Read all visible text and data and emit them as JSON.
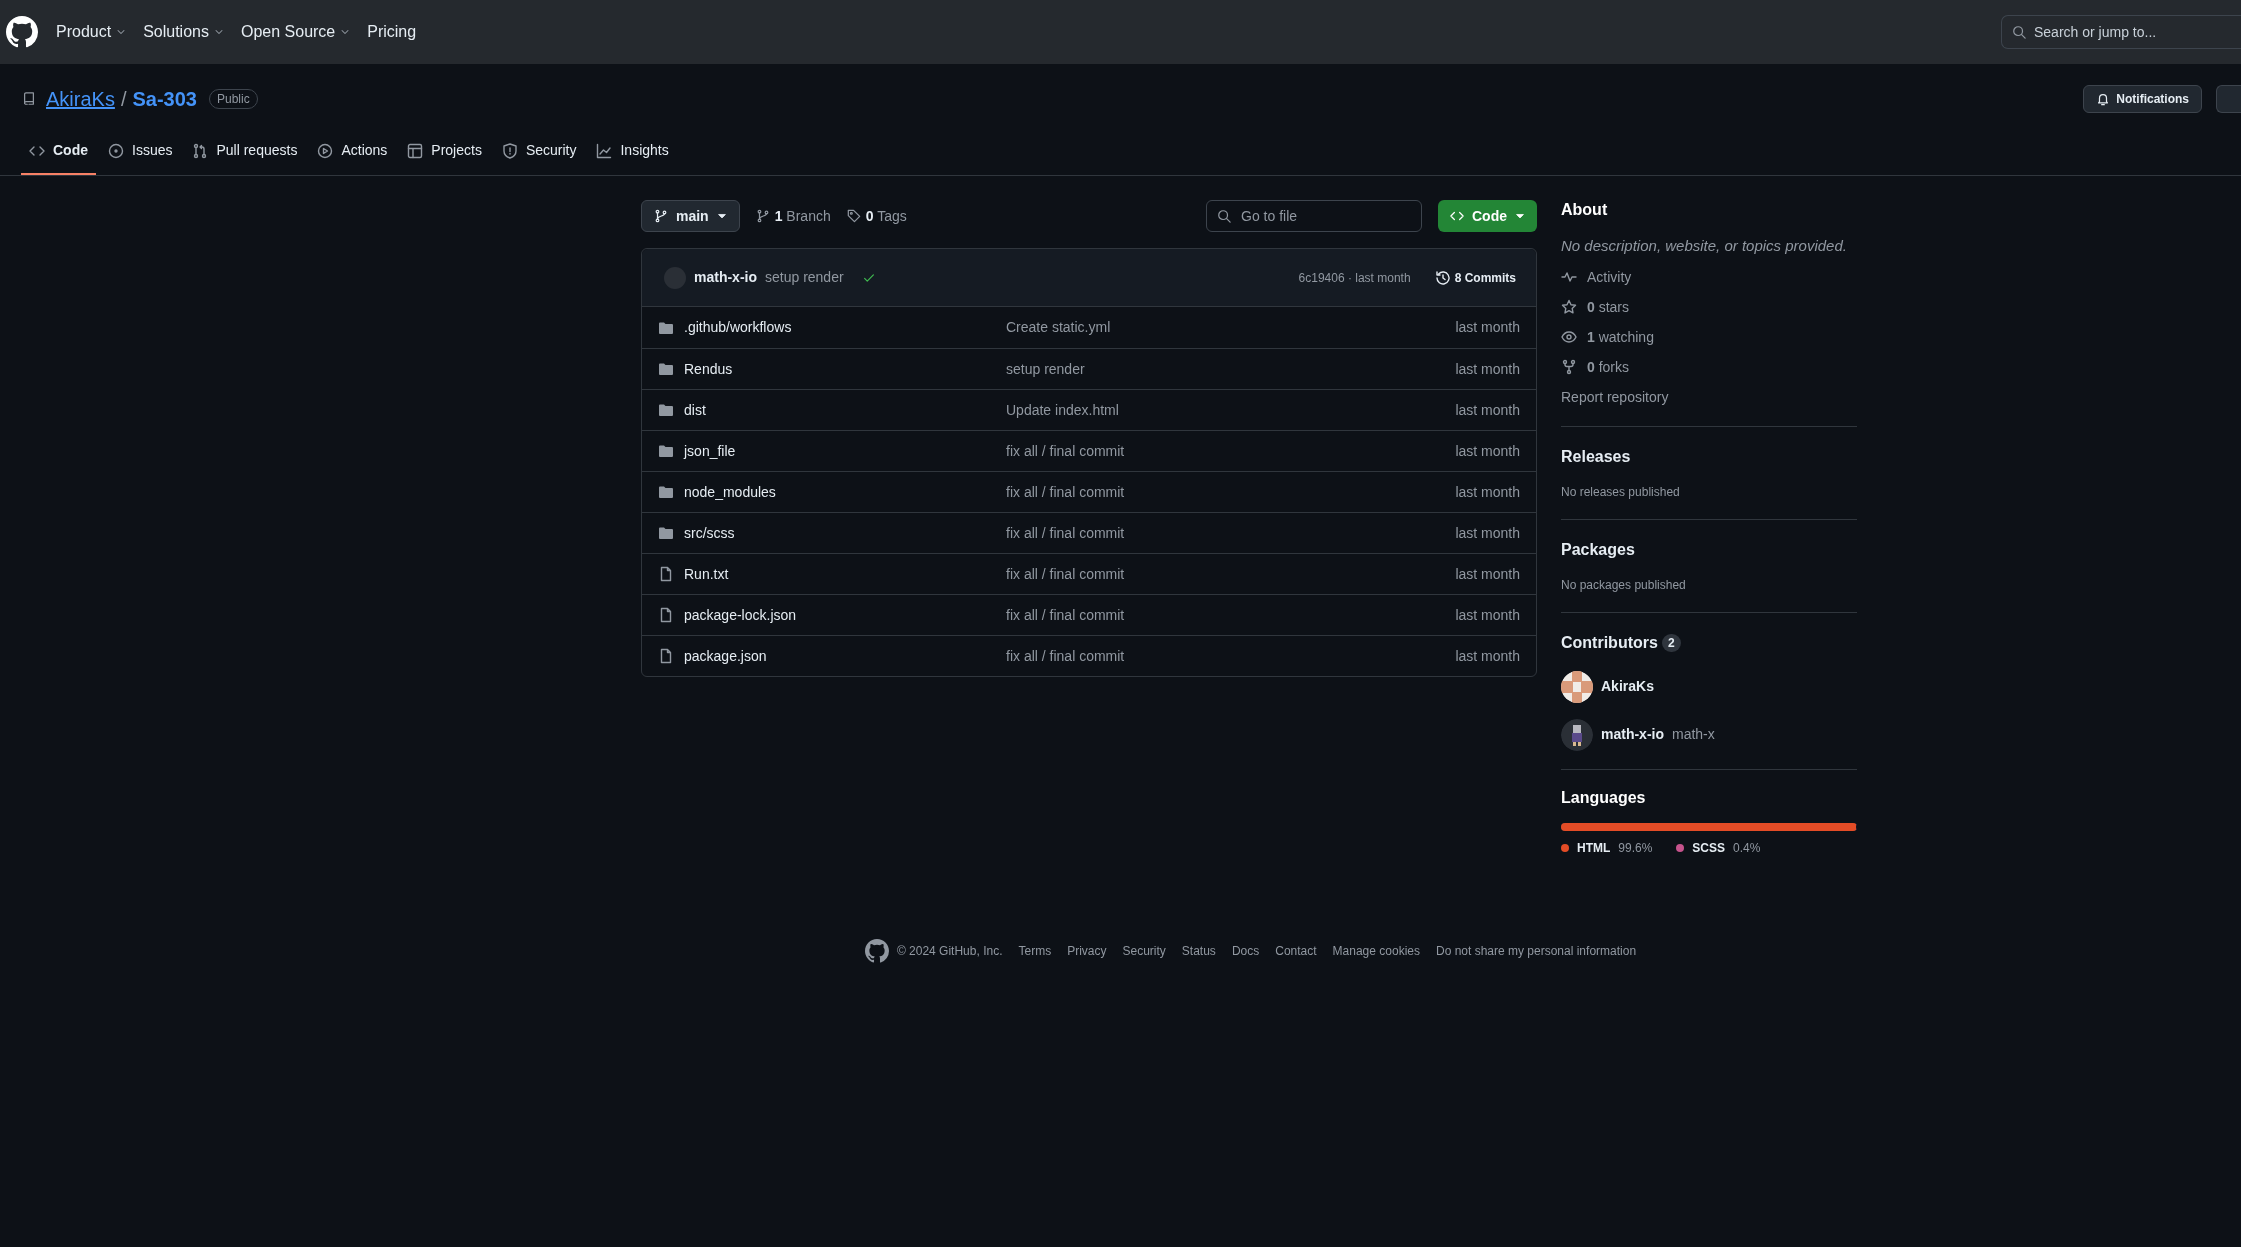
{
  "header": {
    "nav": [
      {
        "label": "Product",
        "dropdown": true
      },
      {
        "label": "Solutions",
        "dropdown": true
      },
      {
        "label": "Open Source",
        "dropdown": true
      },
      {
        "label": "Pricing",
        "dropdown": false
      }
    ],
    "search": {
      "placeholder": "Search or jump to..."
    }
  },
  "repo": {
    "owner": "AkiraKs",
    "separator": "/",
    "name": "Sa-303",
    "visibility": "Public",
    "notifications": "Notifications"
  },
  "tabs": [
    {
      "label": "Code",
      "kind": "code",
      "selected": true
    },
    {
      "label": "Issues",
      "kind": "issues",
      "selected": false
    },
    {
      "label": "Pull requests",
      "kind": "pulls",
      "selected": false
    },
    {
      "label": "Actions",
      "kind": "actions",
      "selected": false
    },
    {
      "label": "Projects",
      "kind": "projects",
      "selected": false
    },
    {
      "label": "Security",
      "kind": "security",
      "selected": false
    },
    {
      "label": "Insights",
      "kind": "insights",
      "selected": false
    }
  ],
  "toolbar": {
    "branch": "main",
    "branches": "**1** Branch",
    "tags": "**0** Tags",
    "go_to_file": {
      "placeholder": "Go to file"
    },
    "code_button": "Code"
  },
  "commit": {
    "author": "math-x-io",
    "message": "setup render",
    "checks_passed": true,
    "hash_time": "6c19406 · last month",
    "commits": "8 Commits"
  },
  "files": [
    {
      "kind": "folder",
      "name": ".github/workflows",
      "message": "Create static.yml",
      "time": "last month"
    },
    {
      "kind": "folder",
      "name": "Rendus",
      "message": "setup render",
      "time": "last month"
    },
    {
      "kind": "folder",
      "name": "dist",
      "message": "Update index.html",
      "time": "last month"
    },
    {
      "kind": "folder",
      "name": "json_file",
      "message": "fix all / final commit",
      "time": "last month"
    },
    {
      "kind": "folder",
      "name": "node_modules",
      "message": "fix all / final commit",
      "time": "last month"
    },
    {
      "kind": "folder",
      "name": "src/scss",
      "message": "fix all / final commit",
      "time": "last month"
    },
    {
      "kind": "file",
      "name": "Run.txt",
      "message": "fix all / final commit",
      "time": "last month"
    },
    {
      "kind": "file",
      "name": "package-lock.json",
      "message": "fix all / final commit",
      "time": "last month"
    },
    {
      "kind": "file",
      "name": "package.json",
      "message": "fix all / final commit",
      "time": "last month"
    }
  ],
  "about": {
    "title": "About",
    "description": "No description, website, or topics provided.",
    "stats": [
      {
        "kind": "activity",
        "text": "Activity"
      },
      {
        "kind": "star",
        "text": "**0** stars"
      },
      {
        "kind": "eye",
        "text": "**1** watching"
      },
      {
        "kind": "fork",
        "text": "**0** forks"
      }
    ],
    "report": "Report repository"
  },
  "releases": {
    "title": "Releases",
    "text": "No releases published"
  },
  "packages": {
    "title": "Packages",
    "text": "No packages published"
  },
  "contributors": {
    "title": "Contributors",
    "count": "2",
    "people": [
      {
        "login": "AkiraKs",
        "kind": "pattern"
      },
      {
        "login": "math-x-io",
        "name": "math-x",
        "kind": "figure"
      }
    ]
  },
  "languages": {
    "title": "Languages",
    "items": [
      {
        "name": "HTML",
        "percent": "99.6%",
        "color": "#e34c26",
        "level": 0.996
      },
      {
        "name": "SCSS",
        "percent": "0.4%",
        "color": "#c6538c",
        "level": 0.004
      }
    ]
  },
  "footer": {
    "copyright": "© 2024 GitHub, Inc.",
    "links": [
      "Terms",
      "Privacy",
      "Security",
      "Status",
      "Docs",
      "Contact",
      "Manage cookies",
      "Do not share my personal information"
    ]
  }
}
